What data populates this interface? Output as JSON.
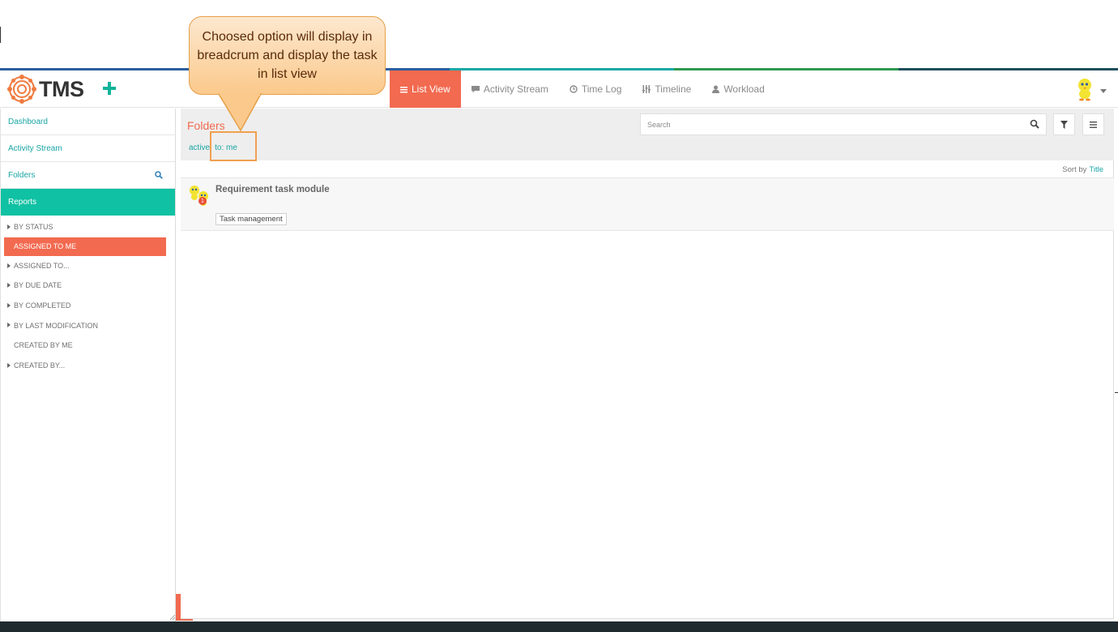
{
  "app": {
    "name": "TMS"
  },
  "callout": {
    "text": "Choosed option will display in breadcrum and display the task in list view"
  },
  "nav": {
    "tabs": [
      {
        "label": "List View",
        "icon": "list-icon",
        "active": true
      },
      {
        "label": "Activity Stream",
        "icon": "comment-icon",
        "active": false
      },
      {
        "label": "Time Log",
        "icon": "clock-icon",
        "active": false
      },
      {
        "label": "Timeline",
        "icon": "timeline-bars-icon",
        "active": false
      },
      {
        "label": "Workload",
        "icon": "user-icon",
        "active": false
      }
    ]
  },
  "sidebar": {
    "links": [
      {
        "label": "Dashboard"
      },
      {
        "label": "Activity Stream"
      },
      {
        "label": "Folders"
      },
      {
        "label": "Reports"
      }
    ],
    "reports": [
      {
        "label": "BY STATUS",
        "expandable": true,
        "active": false
      },
      {
        "label": "ASSIGNED TO ME",
        "expandable": false,
        "active": true
      },
      {
        "label": "ASSIGNED TO...",
        "expandable": true,
        "active": false
      },
      {
        "label": "BY DUE DATE",
        "expandable": true,
        "active": false
      },
      {
        "label": "BY COMPLETED",
        "expandable": true,
        "active": false
      },
      {
        "label": "BY LAST MODIFICATION",
        "expandable": true,
        "active": false
      },
      {
        "label": "CREATED BY ME",
        "expandable": false,
        "active": false
      },
      {
        "label": "CREATED BY...",
        "expandable": true,
        "active": false
      }
    ]
  },
  "main": {
    "title": "Folders",
    "breadcrumb": [
      "active",
      "to: me"
    ],
    "search": {
      "placeholder": "Search"
    },
    "sort": {
      "label": "Sort by",
      "value": "Title"
    },
    "tasks": [
      {
        "title": "Requirement task module",
        "tag": "Task management",
        "badge": "1"
      }
    ]
  },
  "colors": {
    "accent": "#f26a50",
    "teal": "#10c1a3",
    "link": "#1aa5a5"
  }
}
